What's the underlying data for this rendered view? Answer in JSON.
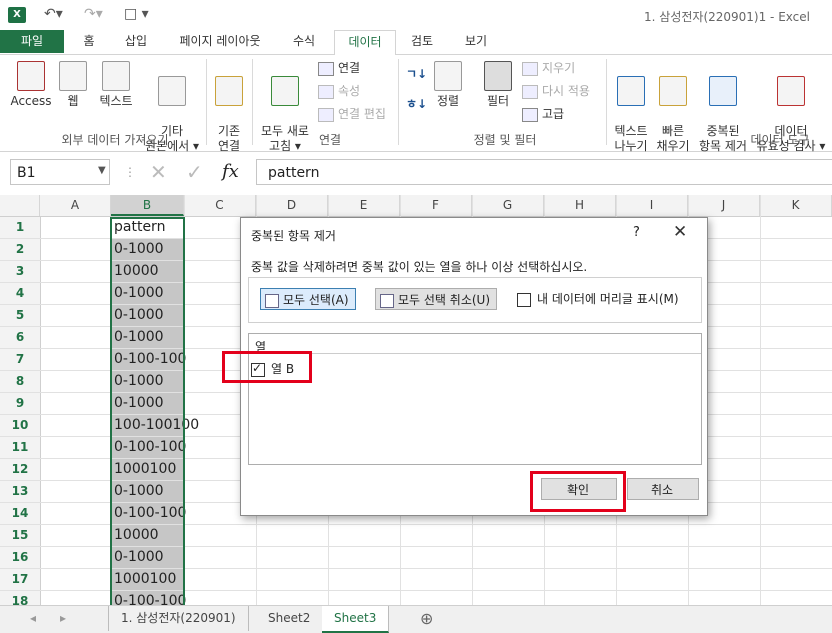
{
  "window": {
    "title": "1. 삼성전자(220901)1 - Excel",
    "app_icon": "X"
  },
  "ribbon_tabs": [
    "파일",
    "홈",
    "삽입",
    "페이지 레이아웃",
    "수식",
    "데이터",
    "검토",
    "보기"
  ],
  "ribbon": {
    "access": "Access",
    "web": "웹",
    "text": "텍스트",
    "other_sources": "기타\n원본에서 ▾",
    "existing_connections": "기존\n연결",
    "refresh_all": "모두 새로\n고침 ▾",
    "connections": "연결",
    "properties": "속성",
    "edit_links": "연결 편집",
    "sort_az": "ㄱ↓",
    "sort_za": "ㅎ↓",
    "sort": "정렬",
    "filter": "필터",
    "clear": "지우기",
    "reapply": "다시 적용",
    "advanced": "고급",
    "text_to_columns": "텍스트\n나누기",
    "flash_fill": "빠른\n채우기",
    "remove_duplicates": "중복된\n항목 제거",
    "data_validation": "데이터\n유효성 검사 ▾",
    "group_external": "외부 데이터 가져오기",
    "group_connections": "연결",
    "group_sort_filter": "정렬 및 필터",
    "group_data_tools": "데이터 도구"
  },
  "formula_bar": {
    "name_box": "B1",
    "fx": "fx",
    "formula": "pattern"
  },
  "columns": [
    "A",
    "B",
    "C",
    "D",
    "E",
    "F",
    "G",
    "H",
    "I",
    "J",
    "K"
  ],
  "rows": [
    {
      "n": "1",
      "b": "pattern"
    },
    {
      "n": "2",
      "b": "0-1000"
    },
    {
      "n": "3",
      "b": "10000"
    },
    {
      "n": "4",
      "b": "0-1000"
    },
    {
      "n": "5",
      "b": "0-1000"
    },
    {
      "n": "6",
      "b": "0-1000"
    },
    {
      "n": "7",
      "b": "0-100-100"
    },
    {
      "n": "8",
      "b": "0-1000"
    },
    {
      "n": "9",
      "b": "0-1000"
    },
    {
      "n": "10",
      "b": "100-100100"
    },
    {
      "n": "11",
      "b": "0-100-100"
    },
    {
      "n": "12",
      "b": "1000100"
    },
    {
      "n": "13",
      "b": "0-1000"
    },
    {
      "n": "14",
      "b": "0-100-100"
    },
    {
      "n": "15",
      "b": "10000"
    },
    {
      "n": "16",
      "b": "0-1000"
    },
    {
      "n": "17",
      "b": "1000100"
    },
    {
      "n": "18",
      "b": "0-100-100"
    }
  ],
  "sheet_tabs": [
    "1. 삼성전자(220901)",
    "Sheet2",
    "Sheet3"
  ],
  "active_sheet": "Sheet3",
  "dialog": {
    "title": "중복된 항목 제거",
    "help": "?",
    "close": "✕",
    "instruction": "중복 값을 삭제하려면 중복 값이 있는 열을 하나 이상 선택하십시오.",
    "select_all": "모두 선택(A)",
    "unselect_all": "모두 선택 취소(U)",
    "has_headers": "내 데이터에 머리글 표시(M)",
    "has_headers_checked": false,
    "list_header": "열",
    "columns": [
      {
        "label": "열 B",
        "checked": true
      }
    ],
    "ok": "확인",
    "cancel": "취소"
  },
  "colors": {
    "excel_green": "#217346",
    "highlight_red": "#e3001b",
    "selection_gray": "#c6c6c6"
  }
}
